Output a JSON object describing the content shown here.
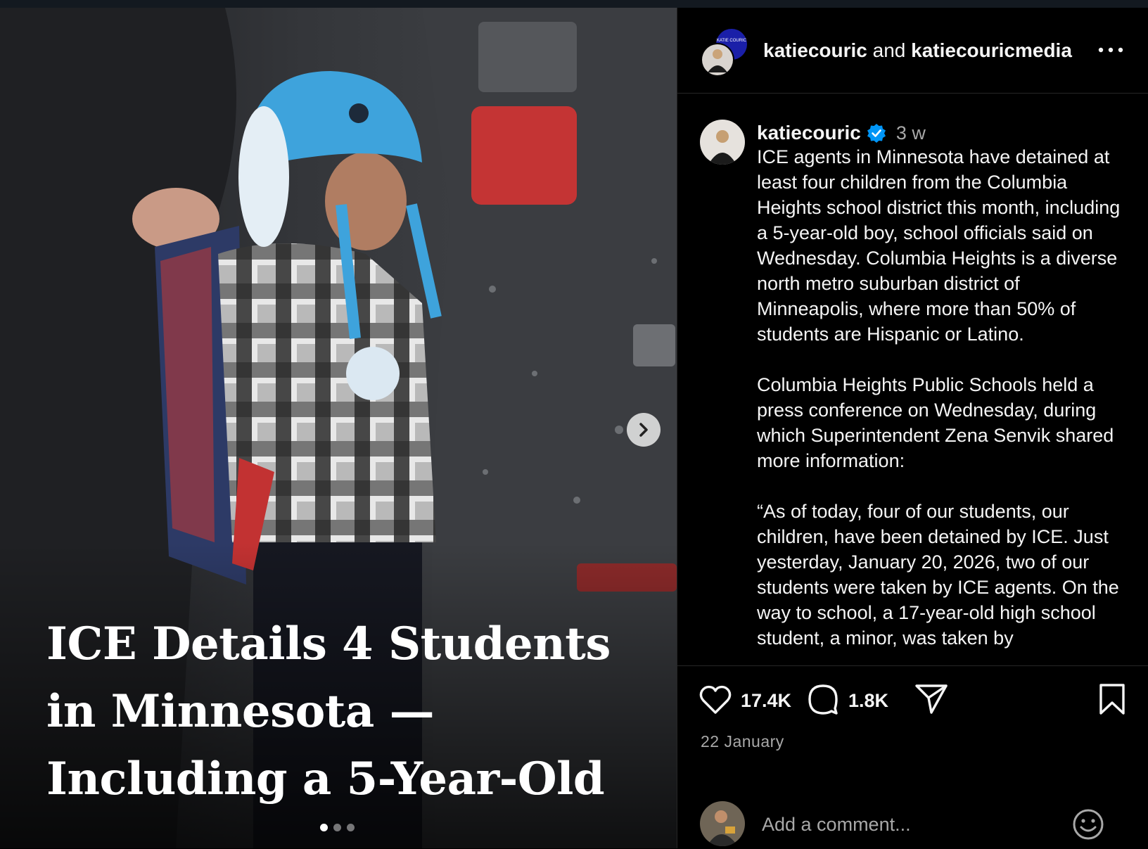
{
  "media": {
    "headline": "ICE Details 4 Students in Minnesota — Including a 5-Year-Old",
    "image_description_icon": "photo",
    "carousel_total": 3,
    "carousel_active_index": 0
  },
  "header": {
    "user1": "katiecouric",
    "conjunction": " and ",
    "user2": "katiecouricmedia",
    "badge_text": "KATIE COURIC"
  },
  "post": {
    "username": "katiecouric",
    "time": "3 w",
    "caption": "ICE agents in Minnesota have detained at least four children from the Columbia Heights school district this month, including a 5-year-old boy, school officials said on Wednesday. Columbia Heights is a diverse north metro suburban district of Minneapolis, where more than 50% of students are Hispanic or Latino.\n\nColumbia Heights Public Schools held a press conference on Wednesday, during which Superintendent Zena Senvik shared more information:\n\n“As of today, four of our students, our children, have been detained by ICE. Just yesterday, January 20, 2026, two of our students were taken by ICE agents. On the way to school, a 17-year-old high school student, a minor, was taken by"
  },
  "actions": {
    "likes": "17.4K",
    "comments": "1.8K",
    "date": "22 January"
  },
  "comment": {
    "placeholder": "Add a comment..."
  },
  "colors": {
    "background": "#000000",
    "text": "#f5f5f5",
    "muted": "#a8a8a8",
    "divider": "#262626",
    "verified": "#0095f6"
  }
}
